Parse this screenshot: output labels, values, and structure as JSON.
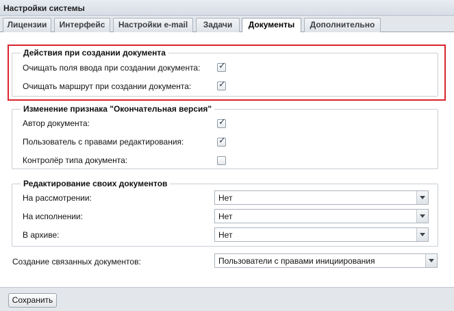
{
  "window": {
    "title": "Настройки системы"
  },
  "tabs": [
    {
      "label": "Лицензии"
    },
    {
      "label": "Интерфейс"
    },
    {
      "label": "Настройки e-mail"
    },
    {
      "label": "Задачи"
    },
    {
      "label": "Документы",
      "active": true
    },
    {
      "label": "Дополнительно"
    }
  ],
  "group_create": {
    "legend": "Действия при создании документа",
    "items": [
      {
        "label": "Очищать поля ввода при создании документа:",
        "checked": true
      },
      {
        "label": "Очищать маршрут при создании документа:",
        "checked": true
      }
    ]
  },
  "group_final": {
    "legend": "Изменение признака \"Окончательная версия\"",
    "items": [
      {
        "label": "Автор документа:",
        "checked": true
      },
      {
        "label": "Пользователь с правами редактирования:",
        "checked": true
      },
      {
        "label": "Контролёр типа документа:",
        "checked": false
      }
    ]
  },
  "group_edit": {
    "legend": "Редактирование своих документов",
    "items": [
      {
        "label": "На рассмотрении:",
        "value": "Нет"
      },
      {
        "label": "На исполнении:",
        "value": "Нет"
      },
      {
        "label": "В архиве:",
        "value": "Нет"
      }
    ]
  },
  "related": {
    "label": "Создание связанных документов:",
    "value": "Пользователи с правами инициирования"
  },
  "footer": {
    "save_label": "Сохранить"
  },
  "colors": {
    "highlight": "#d9232c",
    "checkmark": "#2b3c52"
  }
}
